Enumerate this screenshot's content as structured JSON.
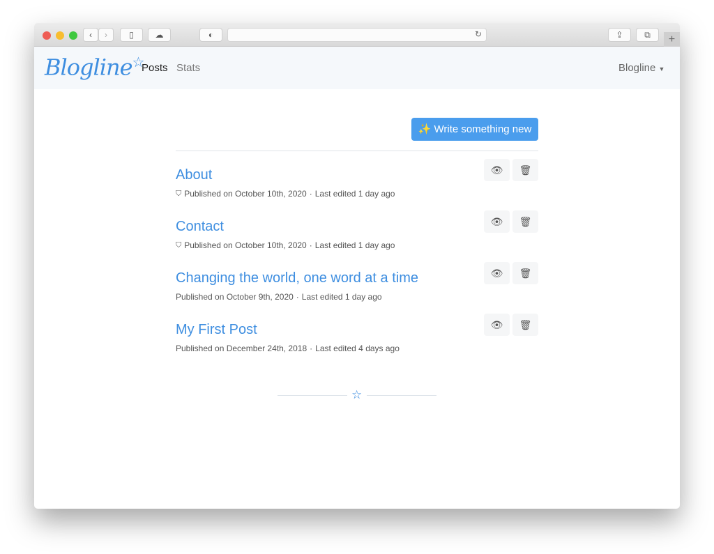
{
  "browser": {
    "colors": {
      "close": "#ee5c54",
      "min": "#f8bd30",
      "max": "#3ec83f"
    }
  },
  "nav": {
    "logo": "Blogline",
    "logo_star": "☆",
    "items": [
      {
        "label": "Posts",
        "active": true
      },
      {
        "label": "Stats",
        "active": false
      }
    ],
    "account": "Blogline"
  },
  "main": {
    "new_button": {
      "icon": "✨",
      "label": "Write something new"
    },
    "posts": [
      {
        "title": "About",
        "published": "Published on October 10th, 2020",
        "edited": "Last edited 1 day ago",
        "page": true
      },
      {
        "title": "Contact",
        "published": "Published on October 10th, 2020",
        "edited": "Last edited 1 day ago",
        "page": true
      },
      {
        "title": "Changing the world, one word at a time",
        "published": "Published on October 9th, 2020",
        "edited": "Last edited 1 day ago",
        "page": false
      },
      {
        "title": "My First Post",
        "published": "Published on December 24th, 2018",
        "edited": "Last edited 4 days ago",
        "page": false
      }
    ],
    "divider_star": "☆"
  }
}
